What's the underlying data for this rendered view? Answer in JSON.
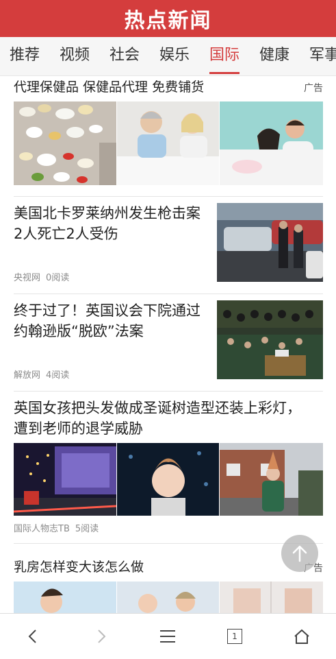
{
  "header": {
    "title": "热点新闻"
  },
  "tabs": [
    {
      "label": "推荐"
    },
    {
      "label": "视频"
    },
    {
      "label": "社会"
    },
    {
      "label": "娱乐"
    },
    {
      "label": "国际",
      "active": true
    },
    {
      "label": "健康"
    },
    {
      "label": "军事"
    }
  ],
  "feed": {
    "ad1": {
      "title": "代理保健品 保健品代理 免费铺货",
      "tag": "广告"
    },
    "n1": {
      "title": "美国北卡罗莱纳州发生枪击案 2人死亡2人受伤",
      "source": "央视网",
      "reads": "0阅读"
    },
    "n2": {
      "title": "终于过了！英国议会下院通过约翰逊版“脱欧”法案",
      "source": "解放网",
      "reads": "4阅读"
    },
    "n3": {
      "title": "英国女孩把头发做成圣诞树造型还装上彩灯，遭到老师的退学威胁",
      "source": "国际人物志TB",
      "reads": "5阅读"
    },
    "ad2": {
      "title": "乳房怎样变大该怎么做",
      "tag": "广告"
    }
  },
  "bottom_nav": {
    "back": "chevron-left-icon",
    "forward": "chevron-right-icon",
    "menu": "menu-icon",
    "tabs_count": "1",
    "home": "home-icon"
  },
  "colors": {
    "brand": "#d43d3d",
    "text": "#222222",
    "meta": "#8a8a8a"
  }
}
